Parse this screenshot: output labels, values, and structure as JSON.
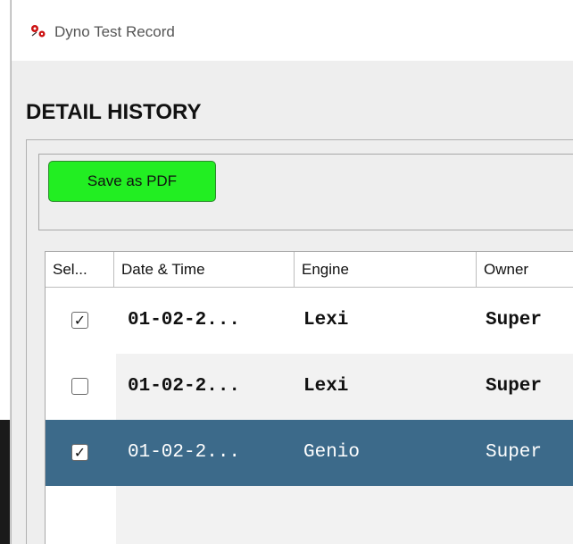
{
  "window": {
    "title": "Dyno Test Record"
  },
  "heading": "DETAIL HISTORY",
  "toolbar": {
    "save_pdf_label": "Save as PDF"
  },
  "table": {
    "columns": [
      "Sel...",
      "Date & Time",
      "Engine",
      "Owner"
    ],
    "rows": [
      {
        "checked": "✓",
        "date": "01-02-2...",
        "engine": "Lexi",
        "owner": "Super"
      },
      {
        "checked": "",
        "date": "01-02-2...",
        "engine": "Lexi",
        "owner": "Super"
      },
      {
        "checked": "✓",
        "date": "01-02-2...",
        "engine": "Genio",
        "owner": "Super"
      }
    ]
  },
  "colors": {
    "save_button": "#22ee22",
    "selected_row": "#3c6a8a",
    "alt_row": "#f2f2f2"
  }
}
